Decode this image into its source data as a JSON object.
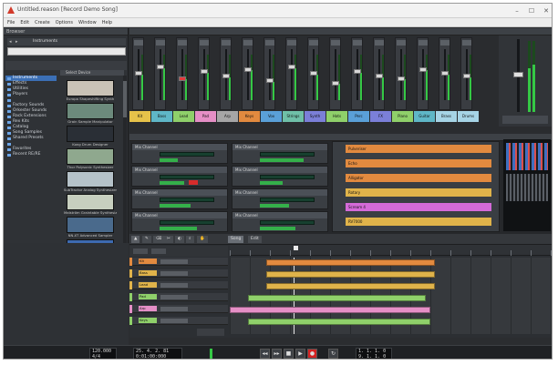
{
  "window": {
    "title": "Untitled.reason [Record Demo Song]",
    "controls": [
      "–",
      "☐",
      "✕"
    ]
  },
  "menu": [
    "File",
    "Edit",
    "Create",
    "Options",
    "Window",
    "Help"
  ],
  "browser": {
    "header": "Browser",
    "location": "Instruments",
    "tree": [
      {
        "label": "Instruments",
        "selected": true
      },
      {
        "label": "Effects",
        "selected": false
      },
      {
        "label": "Utilities",
        "selected": false
      },
      {
        "label": "Players",
        "selected": false
      },
      {
        "label": "",
        "selected": false
      },
      {
        "label": "Factory Sounds",
        "selected": false
      },
      {
        "label": "Orkester Sounds",
        "selected": false
      },
      {
        "label": "Rack Extensions",
        "selected": false
      },
      {
        "label": "Rex Kits",
        "selected": false
      },
      {
        "label": "Catalog",
        "selected": false
      },
      {
        "label": "Song Samples",
        "selected": false
      },
      {
        "label": "Shared Presets",
        "selected": false
      },
      {
        "label": "",
        "selected": false
      },
      {
        "label": "Favorites",
        "selected": false
      },
      {
        "label": "Recent RE/RE",
        "selected": false
      }
    ],
    "devices_header": "Select Device",
    "devices": [
      {
        "name": "Europa Shapeshifting Synth",
        "color": "#c9c2b6"
      },
      {
        "name": "Grain Sample Manipulator",
        "color": "#6c8a7c"
      },
      {
        "name": "Kong Drum Designer",
        "color": "#2a2f36"
      },
      {
        "name": "Thor Polysonic Synthesizer",
        "color": "#8fa88e"
      },
      {
        "name": "SubTractor Analog Synthesizer",
        "color": "#b5c2c9"
      },
      {
        "name": "Malström Graintable Synthesizer",
        "color": "#c7cfbf"
      },
      {
        "name": "NN-XT Advanced Sampler",
        "color": "#4a6a8c"
      },
      {
        "name": "ID8 Instrument Device",
        "color": "#3d6ab0"
      }
    ]
  },
  "mixer": {
    "channels": [
      {
        "label": "Kit",
        "color": "#e6c24a",
        "level": 0.55
      },
      {
        "label": "Bass",
        "color": "#5fb7c7",
        "level": 0.7
      },
      {
        "label": "Lead",
        "color": "#8fd06a",
        "level": 0.45
      },
      {
        "label": "Pad",
        "color": "#e58fc6",
        "level": 0.6
      },
      {
        "label": "Arp",
        "color": "#a6a6a6",
        "level": 0.5
      },
      {
        "label": "Keys",
        "color": "#e28a3f",
        "level": 0.65
      },
      {
        "label": "Vox",
        "color": "#5aa0d8",
        "level": 0.4
      },
      {
        "label": "Strings",
        "color": "#6fc0a8",
        "level": 0.7
      },
      {
        "label": "Synth",
        "color": "#7b7fd8",
        "level": 0.55
      },
      {
        "label": "Hats",
        "color": "#8fd06a",
        "level": 0.35
      },
      {
        "label": "Perc",
        "color": "#5aa0d8",
        "level": 0.6
      },
      {
        "label": "FX",
        "color": "#7b7fd8",
        "level": 0.5
      },
      {
        "label": "Piano",
        "color": "#8fd06a",
        "level": 0.45
      },
      {
        "label": "Guitar",
        "color": "#5fb7c7",
        "level": 0.65
      },
      {
        "label": "Brass",
        "color": "#a6d4e6",
        "level": 0.55
      },
      {
        "label": "Drums",
        "color": "#a6d4e6",
        "level": 0.5
      }
    ]
  },
  "rack": {
    "devices": [
      "Mix Channel",
      "Mix Channel",
      "Mix Channel",
      "Mix Channel"
    ],
    "combinator_rows": [
      {
        "label": "Pulveriser",
        "color": "#e28a3f"
      },
      {
        "label": "Echo",
        "color": "#e28a3f"
      },
      {
        "label": "Alligator",
        "color": "#e28a3f"
      },
      {
        "label": "Rotary",
        "color": "#e0b34a"
      },
      {
        "label": "Scream 4",
        "color": "#d46ad8"
      },
      {
        "label": "RV7000",
        "color": "#e0b34a"
      }
    ]
  },
  "sequencer": {
    "toolbar": {
      "mode": "Song",
      "edit": "Edit"
    },
    "tracks": [
      {
        "name": "Kit",
        "color": "#e28a3f"
      },
      {
        "name": "Bass",
        "color": "#e0b34a"
      },
      {
        "name": "Lead",
        "color": "#e0b34a"
      },
      {
        "name": "Pad",
        "color": "#8fd06a"
      },
      {
        "name": "Arp",
        "color": "#e58fc6"
      },
      {
        "name": "Keys",
        "color": "#8fd06a"
      }
    ]
  },
  "transport": {
    "tempo": "120.000",
    "signature": "4/4",
    "position": "25. 4. 2. 81",
    "time": "0:01:00:000",
    "left_loc": "1. 1. 1. 0",
    "right_loc": "9. 1. 1. 0"
  }
}
